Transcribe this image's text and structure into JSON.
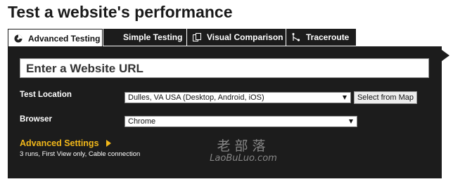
{
  "page_title": "Test a website's performance",
  "tabs": [
    {
      "label": "Advanced Testing",
      "icon": "gauge-icon",
      "active": true
    },
    {
      "label": "Simple Testing",
      "icon": "",
      "active": false
    },
    {
      "label": "Visual Comparison",
      "icon": "compare-icon",
      "active": false
    },
    {
      "label": "Traceroute",
      "icon": "traceroute-icon",
      "active": false
    }
  ],
  "form": {
    "url_placeholder": "Enter a Website URL",
    "test_location_label": "Test Location",
    "test_location_value": "Dulles, VA USA (Desktop, Android, iOS)",
    "select_from_map_label": "Select from Map",
    "browser_label": "Browser",
    "browser_value": "Chrome",
    "advanced_settings_label": "Advanced Settings",
    "advanced_summary": "3 runs, First View only, Cable connection"
  },
  "watermark": {
    "main": "老部落",
    "sub": "LaoBuLuo.com"
  },
  "colors": {
    "panel": "#1c1c1c",
    "accent": "#f2b81a"
  }
}
